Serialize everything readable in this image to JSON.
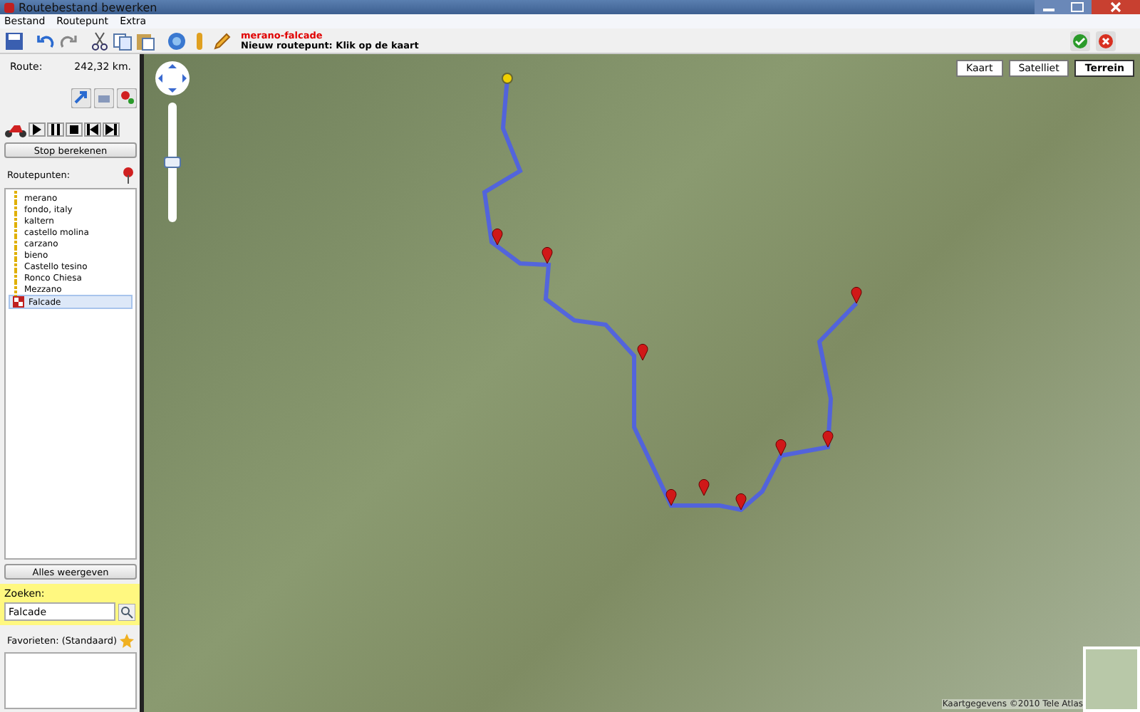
{
  "window": {
    "title": "Routebestand bewerken"
  },
  "menu": [
    {
      "label": "Bestand"
    },
    {
      "label": "Routepunt"
    },
    {
      "label": "Extra"
    }
  ],
  "header": {
    "route_name": "merano-falcade",
    "hint": "Nieuw routepunt: Klik op de kaart"
  },
  "route": {
    "label": "Route:",
    "distance": "242,32 km."
  },
  "stop_button": "Stop berekenen",
  "waypoints": {
    "label": "Routepunten:",
    "items": [
      {
        "name": "merano",
        "kind": "via",
        "selected": false
      },
      {
        "name": "fondo, italy",
        "kind": "via",
        "selected": false
      },
      {
        "name": "kaltern",
        "kind": "via",
        "selected": false
      },
      {
        "name": "castello molina",
        "kind": "via",
        "selected": false
      },
      {
        "name": "carzano",
        "kind": "via",
        "selected": false
      },
      {
        "name": "bieno",
        "kind": "via",
        "selected": false
      },
      {
        "name": "Castello tesino",
        "kind": "via",
        "selected": false
      },
      {
        "name": "Ronco Chiesa",
        "kind": "via",
        "selected": false
      },
      {
        "name": "Mezzano",
        "kind": "via",
        "selected": false
      },
      {
        "name": "Falcade",
        "kind": "finish",
        "selected": true
      }
    ]
  },
  "show_all_button": "Alles weergeven",
  "search": {
    "label": "Zoeken:",
    "value": "Falcade"
  },
  "favorites": {
    "label": "Favorieten: (Standaard)"
  },
  "map": {
    "types": [
      {
        "label": "Kaart",
        "selected": false
      },
      {
        "label": "Satelliet",
        "selected": false
      },
      {
        "label": "Terrein",
        "selected": true
      }
    ],
    "attribution": "Kaartgegevens ©2010 Tele Atlas",
    "zoom": {
      "level": 0.5
    }
  }
}
